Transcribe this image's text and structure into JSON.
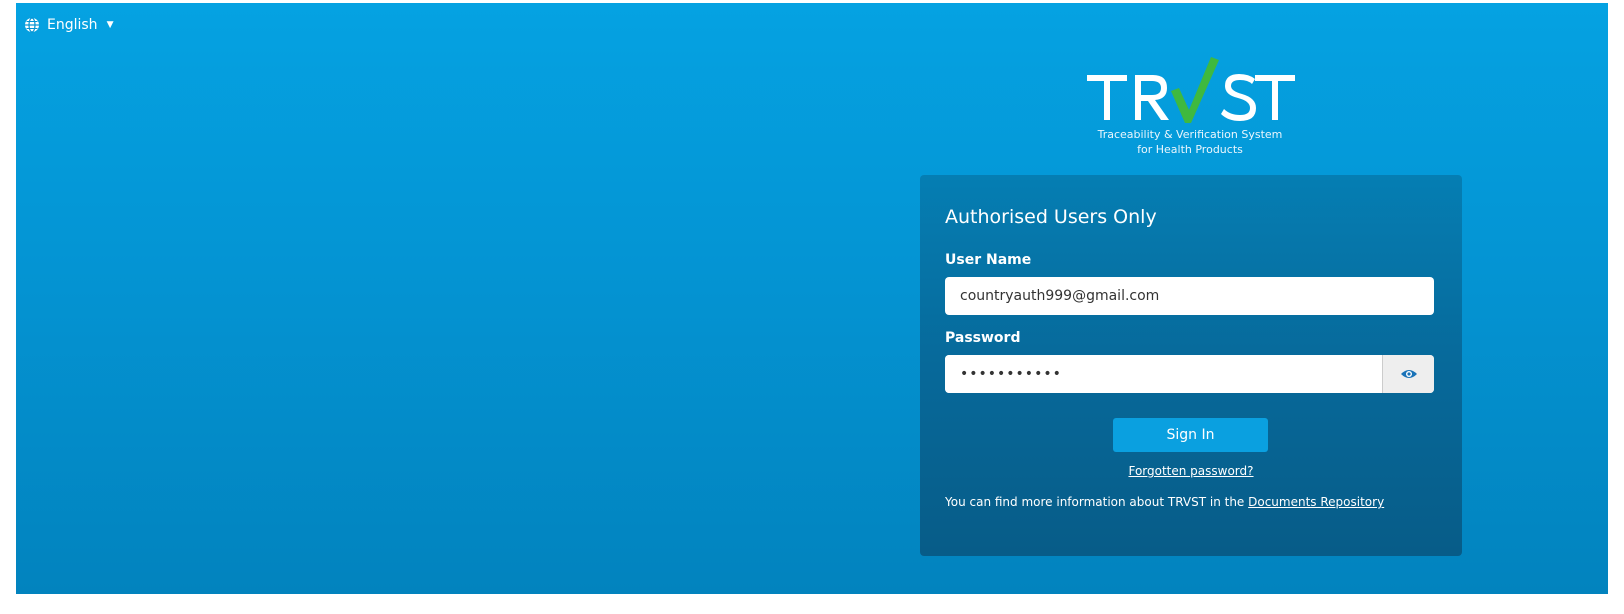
{
  "language": {
    "label": "English"
  },
  "logo": {
    "wordmark": "TRVST",
    "tagline_line1": "Traceability & Verification System",
    "tagline_line2": "for Health Products",
    "check_color": "#3fb93f"
  },
  "login": {
    "title": "Authorised Users Only",
    "username_label": "User Name",
    "username_value": "countryauth999@gmail.com",
    "password_label": "Password",
    "password_value": "•••••••••••",
    "show_password_icon": "eye-icon",
    "sign_in_label": "Sign In",
    "forgot_link": "Forgotten password?",
    "info_text": "You can find more information about TRVST in the ",
    "info_link": "Documents Repository"
  },
  "colors": {
    "background": "#0494d3",
    "panel": "#07699a",
    "button": "#0aa0e0"
  }
}
